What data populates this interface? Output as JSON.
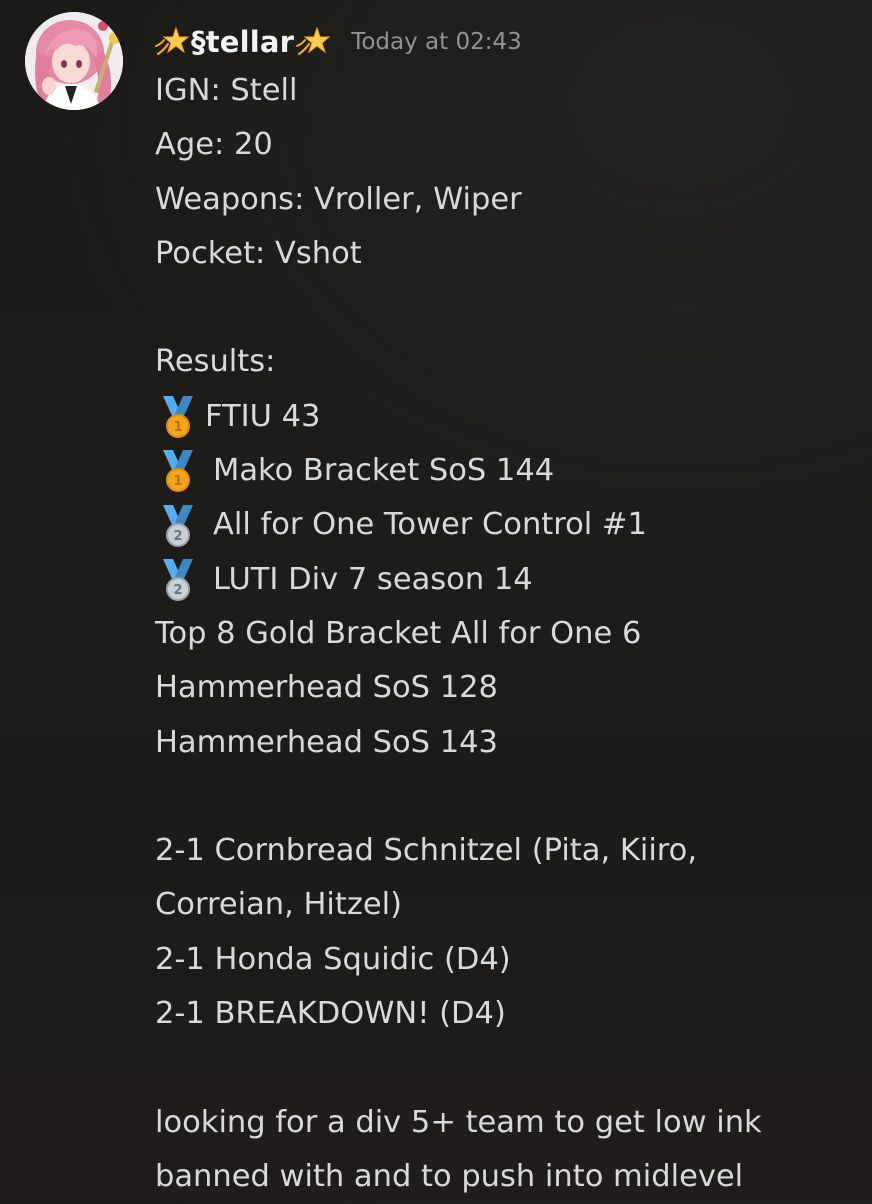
{
  "message": {
    "author": {
      "name": "§tellar",
      "name_prefix_icon": "dizzy-star-emoji",
      "name_suffix_icon": "dizzy-star-emoji"
    },
    "timestamp": "Today at 02:43",
    "lines": {
      "ign": "IGN: Stell",
      "age": "Age: 20",
      "weapons": "Weapons: Vroller, Wiper",
      "pocket": "Pocket: Vshot",
      "results_header": "Results:",
      "result_1": "FTIU 43",
      "result_2": "Mako Bracket SoS 144",
      "result_3": "All for One Tower Control #1",
      "result_4": "LUTI Div 7 season 14",
      "result_5": "Top 8 Gold Bracket All for One 6",
      "result_6": "Hammerhead SoS 128",
      "result_7": "Hammerhead SoS 143",
      "team_1": "2-1 Cornbread Schnitzel (Pita, Kiiro,",
      "team_1_cont": "Correian, Hitzel)",
      "team_2": "2-1 Honda Squidic (D4)",
      "team_3": "2-1 BREAKDOWN! (D4)",
      "closing_1": "looking for a div 5+ team to get low ink",
      "closing_2": "banned with and to push into midlevel"
    },
    "medals": {
      "result_1": "1",
      "result_2": "1",
      "result_3": "2",
      "result_4": "2"
    }
  },
  "colors": {
    "background": "#1c1b18",
    "text": "#d8d9db",
    "username": "#f2f3f5",
    "timestamp": "#909298",
    "gold_medal": "#f4a51c",
    "silver_medal": "#c9cfd6",
    "ribbon": "#55acee"
  }
}
